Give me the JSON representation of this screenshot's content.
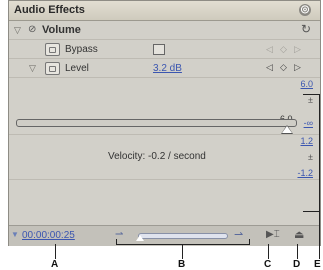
{
  "panel": {
    "title": "Audio Effects",
    "menu_icon": "◎"
  },
  "effect": {
    "name": "Volume",
    "bypass_label": "Bypass",
    "level_label": "Level",
    "level_value": "3.2 dB"
  },
  "level_graph": {
    "slider_min": "-∞",
    "slider_max": "6.0",
    "top_scale": "6.0",
    "mid_scale": "±",
    "bottom_scale": "-∞"
  },
  "velocity_graph": {
    "label": "Velocity: -0.2 / second",
    "top_scale": "1.2",
    "mid_scale": "±",
    "bottom_scale": "-1.2"
  },
  "bottom": {
    "timecode": "00:00:00:25"
  },
  "callouts": [
    "A",
    "B",
    "C",
    "D",
    "E"
  ]
}
